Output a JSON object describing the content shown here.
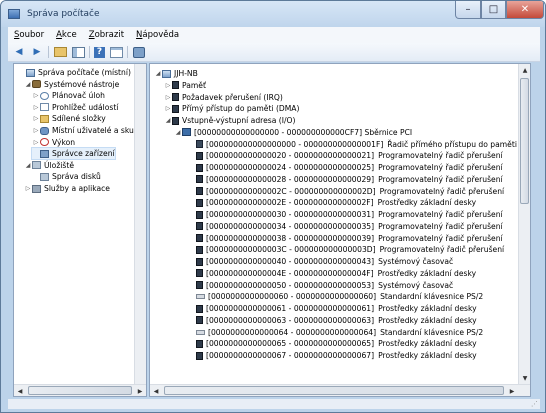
{
  "window": {
    "title": "Správa počítače",
    "controls": {
      "minimize": "–",
      "maximize": "□",
      "close": "✕"
    }
  },
  "menu": [
    {
      "key": "S",
      "rest": "oubor"
    },
    {
      "key": "A",
      "rest": "kce"
    },
    {
      "key": "Z",
      "rest": "obrazit"
    },
    {
      "key": "N",
      "rest": "ápověda"
    }
  ],
  "toolbar": {
    "back": "◀",
    "forward": "▶",
    "help": "?"
  },
  "left_tree": [
    {
      "label": "Správa počítače (místní)",
      "icon": "computer-icon",
      "arrow": ""
    },
    {
      "label": "Systémové nástroje",
      "icon": "tools-icon",
      "arrow": "◢"
    },
    {
      "label": "Plánovač úloh",
      "icon": "clock-icon",
      "arrow": "▷"
    },
    {
      "label": "Prohlížeč událostí",
      "icon": "log-icon",
      "arrow": "▷"
    },
    {
      "label": "Sdílené složky",
      "icon": "folder-icon",
      "arrow": "▷"
    },
    {
      "label": "Místní uživatelé a skupiny",
      "icon": "users-icon",
      "arrow": "▷"
    },
    {
      "label": "Výkon",
      "icon": "performance-icon",
      "arrow": "▷"
    },
    {
      "label": "Správce zařízení",
      "icon": "device-manager-icon",
      "arrow": ""
    },
    {
      "label": "Úložiště",
      "icon": "storage-icon",
      "arrow": "◢"
    },
    {
      "label": "Správa disků",
      "icon": "disk-icon",
      "arrow": ""
    },
    {
      "label": "Služby a aplikace",
      "icon": "services-icon",
      "arrow": "▷"
    }
  ],
  "right_tree": {
    "root": "JJH-NB",
    "categories": [
      {
        "label": "Paměť",
        "arrow": "▷"
      },
      {
        "label": "Požadavek přerušení (IRQ)",
        "arrow": "▷"
      },
      {
        "label": "Přímý přístup do paměti (DMA)",
        "arrow": "▷"
      },
      {
        "label": "Vstupně-výstupní adresa (I/O)",
        "arrow": "◢"
      }
    ],
    "pci": "[00000000000000000 - 000000000000CF7]  Sběrnice PCI",
    "items": [
      {
        "range": "[000000000000000000 - 000000000000001F]",
        "name": "Řadič přímého přístupu do paměti (DMA)",
        "icon": "dma"
      },
      {
        "range": "[0000000000000020 - 0000000000000021]",
        "name": "Programovatelný řadič přerušení",
        "icon": "chip"
      },
      {
        "range": "[0000000000000024 - 0000000000000025]",
        "name": "Programovatelný řadič přerušení",
        "icon": "chip"
      },
      {
        "range": "[0000000000000028 - 0000000000000029]",
        "name": "Programovatelný řadič přerušení",
        "icon": "chip"
      },
      {
        "range": "[000000000000002C - 000000000000002D]",
        "name": "Programovatelný řadič přerušení",
        "icon": "chip"
      },
      {
        "range": "[000000000000002E - 000000000000002F]",
        "name": "Prostředky základní desky",
        "icon": "chip"
      },
      {
        "range": "[0000000000000030 - 0000000000000031]",
        "name": "Programovatelný řadič přerušení",
        "icon": "chip"
      },
      {
        "range": "[0000000000000034 - 0000000000000035]",
        "name": "Programovatelný řadič přerušení",
        "icon": "chip"
      },
      {
        "range": "[0000000000000038 - 0000000000000039]",
        "name": "Programovatelný řadič přerušení",
        "icon": "chip"
      },
      {
        "range": "[000000000000003C - 000000000000003D]",
        "name": "Programovatelný řadič přerušení",
        "icon": "chip"
      },
      {
        "range": "[0000000000000040 - 0000000000000043]",
        "name": "Systémový časovač",
        "icon": "chip"
      },
      {
        "range": "[000000000000004E - 000000000000004F]",
        "name": "Prostředky základní desky",
        "icon": "chip"
      },
      {
        "range": "[0000000000000050 - 0000000000000053]",
        "name": "Systémový časovač",
        "icon": "chip"
      },
      {
        "range": "[0000000000000060 - 0000000000000060]",
        "name": "Standardní klávesnice PS/2",
        "icon": "kbd"
      },
      {
        "range": "[0000000000000061 - 0000000000000061]",
        "name": "Prostředky základní desky",
        "icon": "chip"
      },
      {
        "range": "[0000000000000063 - 0000000000000063]",
        "name": "Prostředky základní desky",
        "icon": "chip"
      },
      {
        "range": "[0000000000000064 - 0000000000000064]",
        "name": "Standardní klávesnice PS/2",
        "icon": "kbd"
      },
      {
        "range": "[0000000000000065 - 0000000000000065]",
        "name": "Prostředky základní desky",
        "icon": "chip"
      },
      {
        "range": "[0000000000000067 - 0000000000000067]",
        "name": "Prostředky základní desky",
        "icon": "chip"
      }
    ]
  },
  "scroll": {
    "up": "▲",
    "down": "▼",
    "left": "◀",
    "right": "▶"
  }
}
